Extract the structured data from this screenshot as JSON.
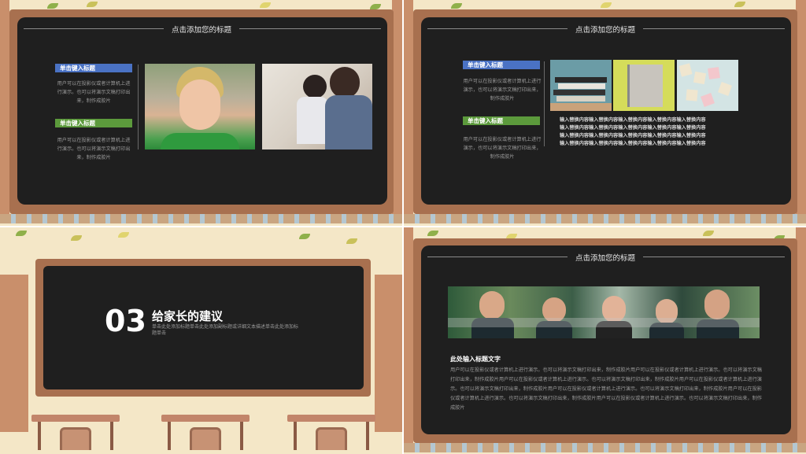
{
  "slides": {
    "s1": {
      "title": "点击添加您的标题",
      "tag1": "单击键入标题",
      "text1": "用户可以在投影仪或者计算机上进行演示。也可以将演示文稿打印出来，制作成胶片",
      "tag2": "单击键入标题",
      "text2": "用户可以在投影仪或者计算机上进行演示。也可以将演示文稿打印出来，制作成胶片"
    },
    "s2": {
      "title": "点击添加您的标题",
      "tag1": "单击键入标题",
      "text1": "用户可以在投影仪或者计算机上进行演示，也可以将演示文稿打印出来，制作成胶片",
      "tag2": "单击键入标题",
      "text2": "用户可以在投影仪或者计算机上进行演示，也可以将演示文稿打印出来，制作成胶片",
      "replace_lines": [
        "输入替换内容输入替换内容输入替换内容输入替换内容输入替换内容",
        "输入替换内容输入替换内容输入替换内容输入替换内容输入替换内容",
        "输入替换内容输入替换内容输入替换内容输入替换内容输入替换内容",
        "输入替换内容输入替换内容输入替换内容输入替换内容输入替换内容"
      ]
    },
    "s3": {
      "number": "03",
      "heading": "给家长的建议",
      "sub": "单击此处添加标题单击此处添加副标题或详细文本描述单击此处添加标题单击"
    },
    "s4": {
      "title": "点击添加您的标题",
      "subheading": "此处输入标题文字",
      "paragraph": "用户可以在投影仪或者计算机上进行演示。也可以将演示文稿打印出来，制作成胶片用户可以在投影仪或者计算机上进行演示。也可以将演示文稿打印出来，制作成胶片用户可以在投影仪或者计算机上进行演示。也可以将演示文稿打印出来，制作成胶片用户可以在投影仪或者计算机上进行演示。也可以将演示文稿打印出来，制作成胶片用户可以在投影仪或者计算机上进行演示。也可以将演示文稿打印出来，制作成胶片用户可以在投影仪或者计算机上进行演示。也可以将演示文稿打印出来，制作成胶片用户可以在投影仪或者计算机上进行演示。也可以将演示文稿打印出来，制作成胶片"
    }
  },
  "colors": {
    "board": "#1f1f1f",
    "frame": "#a8704f",
    "tag_blue": "#4a72c4",
    "tag_green": "#5c9a3c",
    "background": "#f4e7c7"
  }
}
